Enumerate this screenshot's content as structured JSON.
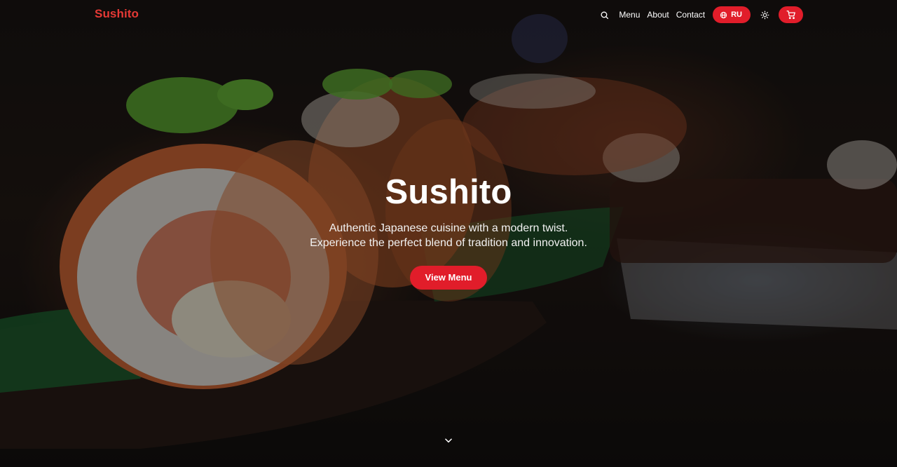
{
  "nav": {
    "logo": "Sushito",
    "links": [
      "Menu",
      "About",
      "Contact"
    ],
    "language": "RU",
    "icons": {
      "search": "search-icon",
      "globe": "globe-icon",
      "theme": "sun-icon",
      "cart": "cart-icon"
    }
  },
  "hero": {
    "title": "Sushito",
    "subtitle_line1": "Authentic Japanese cuisine with a modern twist.",
    "subtitle_line2": "Experience the perfect blend of tradition and innovation.",
    "cta_label": "View Menu",
    "scroll_icon": "chevron-down-icon"
  },
  "colors": {
    "accent": "#e11d2a",
    "logo": "#e53935",
    "text": "#ffffff"
  }
}
